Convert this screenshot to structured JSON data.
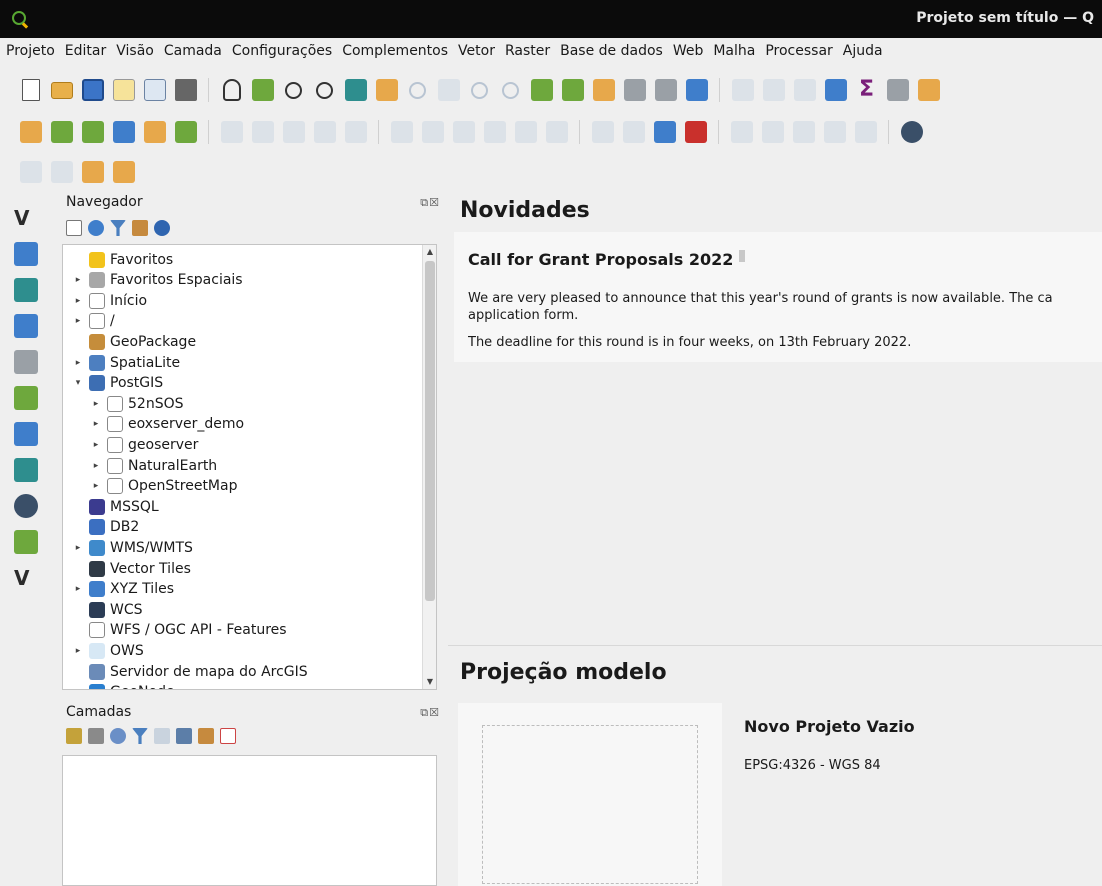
{
  "window": {
    "title": "Projeto sem título — Q"
  },
  "menubar": [
    "Projeto",
    "Editar",
    "Visão",
    "Camada",
    "Configurações",
    "Complementos",
    "Vetor",
    "Raster",
    "Base de dados",
    "Web",
    "Malha",
    "Processar",
    "Ajuda"
  ],
  "toolbar1": [
    {
      "name": "new-project-icon",
      "kind": "doc"
    },
    {
      "name": "open-project-icon",
      "kind": "folder"
    },
    {
      "name": "save-project-icon",
      "kind": "save"
    },
    {
      "name": "new-print-layout-icon",
      "kind": "pages"
    },
    {
      "name": "layout-manager-icon",
      "kind": "layout"
    },
    {
      "name": "style-manager-icon",
      "kind": "style"
    },
    {
      "name": "sep"
    },
    {
      "name": "pan-hand-icon",
      "kind": "hand"
    },
    {
      "name": "pan-to-selection-icon",
      "kind": "green"
    },
    {
      "name": "zoom-in-icon",
      "kind": "zoomin"
    },
    {
      "name": "zoom-out-icon",
      "kind": "zoomout"
    },
    {
      "name": "zoom-full-icon",
      "kind": "teal"
    },
    {
      "name": "zoom-to-selection-icon",
      "kind": "orange"
    },
    {
      "name": "zoom-to-layer-icon",
      "kind": "zoomfaded"
    },
    {
      "name": "zoom-native-icon",
      "kind": "faded"
    },
    {
      "name": "zoom-last-icon",
      "kind": "zoomfaded"
    },
    {
      "name": "zoom-next-icon",
      "kind": "zoomfaded"
    },
    {
      "name": "new-map-view-icon",
      "kind": "green"
    },
    {
      "name": "new-3d-view-icon",
      "kind": "green"
    },
    {
      "name": "bookmark-icon",
      "kind": "orange"
    },
    {
      "name": "show-bookmarks-icon",
      "kind": "gray"
    },
    {
      "name": "temporal-controller-icon",
      "kind": "gray"
    },
    {
      "name": "refresh-icon",
      "kind": "blue"
    },
    {
      "name": "sep"
    },
    {
      "name": "identify-icon",
      "kind": "faded"
    },
    {
      "name": "attribute-table-icon",
      "kind": "faded"
    },
    {
      "name": "statistics-icon",
      "kind": "faded"
    },
    {
      "name": "settings-gear-icon",
      "kind": "blue"
    },
    {
      "name": "sigma-icon",
      "kind": "sigma",
      "glyph": "Σ"
    },
    {
      "name": "measure-icon",
      "kind": "gray"
    },
    {
      "name": "annotation-icon",
      "kind": "orange"
    }
  ],
  "toolbar2": [
    {
      "name": "data-source-manager-icon",
      "kind": "orange"
    },
    {
      "name": "new-geopackage-layer-icon",
      "kind": "green"
    },
    {
      "name": "new-shapefile-layer-icon",
      "kind": "green"
    },
    {
      "name": "new-spatialite-layer-icon",
      "kind": "blue"
    },
    {
      "name": "new-temporary-layer-icon",
      "kind": "orange"
    },
    {
      "name": "new-virtual-layer-icon",
      "kind": "green"
    },
    {
      "name": "sep"
    },
    {
      "name": "current-edits-icon",
      "kind": "faded"
    },
    {
      "name": "toggle-editing-icon",
      "kind": "faded"
    },
    {
      "name": "save-edits-icon",
      "kind": "faded"
    },
    {
      "name": "digitize-icon",
      "kind": "faded"
    },
    {
      "name": "vertex-tool-icon",
      "kind": "faded"
    },
    {
      "name": "sep"
    },
    {
      "name": "delete-selected-icon",
      "kind": "faded"
    },
    {
      "name": "cut-features-icon",
      "kind": "faded"
    },
    {
      "name": "copy-features-icon",
      "kind": "faded"
    },
    {
      "name": "paste-features-icon",
      "kind": "faded"
    },
    {
      "name": "undo-icon",
      "kind": "faded"
    },
    {
      "name": "redo-icon",
      "kind": "faded"
    },
    {
      "name": "sep"
    },
    {
      "name": "label-tool-icon",
      "kind": "faded"
    },
    {
      "name": "label-pin-icon",
      "kind": "faded"
    },
    {
      "name": "label-abc-icon",
      "kind": "blue"
    },
    {
      "name": "label-abc-highlight-icon",
      "kind": "red"
    },
    {
      "name": "sep"
    },
    {
      "name": "label-move-icon",
      "kind": "faded"
    },
    {
      "name": "label-rotate-icon",
      "kind": "faded"
    },
    {
      "name": "label-change-icon",
      "kind": "faded"
    },
    {
      "name": "label-show-hide-icon",
      "kind": "faded"
    },
    {
      "name": "label-pin-unpin-icon",
      "kind": "faded"
    },
    {
      "name": "sep"
    },
    {
      "name": "plugin-globe-icon",
      "kind": "globe"
    }
  ],
  "toolbar3": [
    {
      "name": "select-feature-icon",
      "kind": "faded"
    },
    {
      "name": "select-value-icon",
      "kind": "faded"
    },
    {
      "name": "deselect-features-icon",
      "kind": "orange"
    },
    {
      "name": "open-field-calculator-icon",
      "kind": "orange"
    }
  ],
  "left_toolbar": [
    {
      "name": "add-vector-layer-icon",
      "kind": "vector",
      "glyph": "V"
    },
    {
      "name": "add-raster-layer-icon",
      "kind": "blue"
    },
    {
      "name": "add-mesh-layer-icon",
      "kind": "teal"
    },
    {
      "name": "add-delimited-text-icon",
      "kind": "blue"
    },
    {
      "name": "add-gps-icon",
      "kind": "gray"
    },
    {
      "name": "add-geopackage-icon",
      "kind": "green"
    },
    {
      "name": "add-postgis-icon",
      "kind": "blue"
    },
    {
      "name": "add-wms-icon",
      "kind": "teal"
    },
    {
      "name": "add-wcs-icon",
      "kind": "globe"
    },
    {
      "name": "add-wfs-icon",
      "kind": "green"
    },
    {
      "name": "add-virtual-layer-icon",
      "kind": "vector",
      "glyph": "V"
    }
  ],
  "navigator": {
    "title": "Navegador",
    "items": [
      {
        "label": "Favoritos",
        "icon": "star-icon",
        "color": "#f2c31b",
        "arrow": "",
        "level": 0
      },
      {
        "label": "Favoritos Espaciais",
        "icon": "bookmark-icon",
        "color": "#a7a7a7",
        "arrow": "▸",
        "level": 0
      },
      {
        "label": "Início",
        "icon": "home-icon",
        "color": "#ffffff",
        "arrow": "▸",
        "level": 0
      },
      {
        "label": "/",
        "icon": "folder-icon",
        "color": "#ffffff",
        "arrow": "▸",
        "level": 0
      },
      {
        "label": "GeoPackage",
        "icon": "geopackage-icon",
        "color": "#c58d3b",
        "arrow": "",
        "level": 0
      },
      {
        "label": "SpatiaLite",
        "icon": "feather-icon",
        "color": "#4d7fc0",
        "arrow": "▸",
        "level": 0
      },
      {
        "label": "PostGIS",
        "icon": "elephant-icon",
        "color": "#3d6eb3",
        "arrow": "▾",
        "level": 0
      },
      {
        "label": "52nSOS",
        "icon": "connection-icon",
        "color": "#ffffff",
        "arrow": "▸",
        "level": 1
      },
      {
        "label": "eoxserver_demo",
        "icon": "connection-icon",
        "color": "#ffffff",
        "arrow": "▸",
        "level": 1
      },
      {
        "label": "geoserver",
        "icon": "connection-icon",
        "color": "#ffffff",
        "arrow": "▸",
        "level": 1
      },
      {
        "label": "NaturalEarth",
        "icon": "connection-icon",
        "color": "#ffffff",
        "arrow": "▸",
        "level": 1
      },
      {
        "label": "OpenStreetMap",
        "icon": "connection-icon",
        "color": "#ffffff",
        "arrow": "▸",
        "level": 1
      },
      {
        "label": "MSSQL",
        "icon": "mssql-icon",
        "color": "#3b3b8f",
        "arrow": "",
        "level": 0
      },
      {
        "label": "DB2",
        "icon": "db2-icon",
        "color": "#3b6fc1",
        "arrow": "",
        "level": 0
      },
      {
        "label": "WMS/WMTS",
        "icon": "wms-globe-icon",
        "color": "#3f8acb",
        "arrow": "▸",
        "level": 0
      },
      {
        "label": "Vector Tiles",
        "icon": "vector-tiles-icon",
        "color": "#2f3a46",
        "arrow": "",
        "level": 0
      },
      {
        "label": "XYZ Tiles",
        "icon": "xyz-tiles-icon",
        "color": "#3f7ecb",
        "arrow": "▸",
        "level": 0
      },
      {
        "label": "WCS",
        "icon": "wcs-globe-icon",
        "color": "#2b3c55",
        "arrow": "",
        "level": 0
      },
      {
        "label": "WFS / OGC API - Features",
        "icon": "wfs-icon",
        "color": "#ffffff",
        "arrow": "",
        "level": 0
      },
      {
        "label": "OWS",
        "icon": "ows-icon",
        "color": "#d7e8f5",
        "arrow": "▸",
        "level": 0
      },
      {
        "label": "Servidor de mapa do ArcGIS",
        "icon": "arcgis-icon",
        "color": "#6b8bb8",
        "arrow": "",
        "level": 0
      },
      {
        "label": "GeoNode",
        "icon": "geonode-icon",
        "color": "#2a7fcf",
        "arrow": "▾",
        "level": 0
      }
    ]
  },
  "layers": {
    "title": "Camadas"
  },
  "news": {
    "heading": "Novidades",
    "card_title": "Call for Grant Proposals 2022",
    "paragraph1": "We are very pleased to announce that this year's round of grants is now available. The ca",
    "paragraph1b": "application form.",
    "paragraph2": "The deadline for this round is in four weeks, on 13th February 2022."
  },
  "templates": {
    "heading": "Projeção modelo",
    "items": [
      {
        "name": "Novo Projeto Vazio",
        "crs": "EPSG:4326 - WGS 84"
      }
    ]
  }
}
